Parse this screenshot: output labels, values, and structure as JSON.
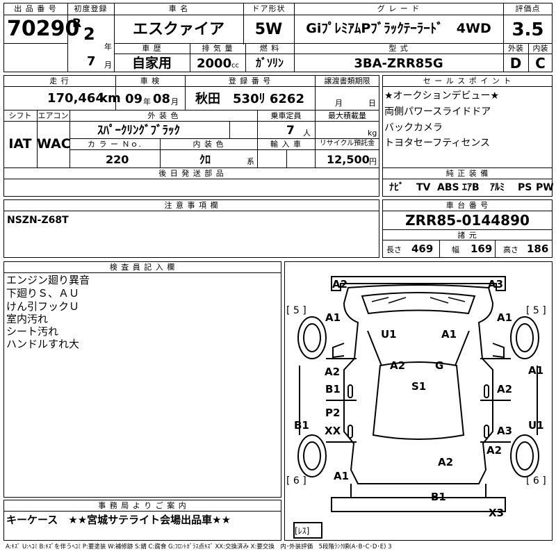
{
  "header": {
    "lot_label": "出 品 番 号",
    "lot_number": "70290",
    "first_reg_label": "初度登録",
    "era": "R",
    "year": "2",
    "year_unit": "年",
    "month": "7",
    "month_unit": "月",
    "car_name_label": "車 名",
    "car_name": "エスクァイア",
    "doors_label": "ドア形状",
    "doors": "5W",
    "grade_label": "グ レ ー ド",
    "grade": "GiﾌﾟﾚﾐｱﾑPﾌﾞﾗｯｸﾃｰﾗｰﾄﾞ　4WD",
    "score_label": "評価点",
    "score": "3.5",
    "history_label": "車 歴",
    "history": "自家用",
    "displacement_label": "排 気 量",
    "displacement": "2000",
    "displacement_unit": "cc",
    "fuel_label": "燃 料",
    "fuel": "ｶﾞｿﾘﾝ",
    "model_label": "型 式",
    "model": "3BA-ZRR85G",
    "exterior_label": "外装",
    "exterior": "D",
    "interior_label": "内装",
    "interior": "C"
  },
  "row2": {
    "mileage_label": "走 行",
    "mileage": "170,464",
    "mileage_unit": "km",
    "inspection_label": "車 検",
    "insp_year": "09",
    "insp_year_unit": "年",
    "insp_month": "08",
    "insp_month_unit": "月",
    "reg_no_label": "登 録 番 号",
    "reg_no": "秋田　530ﾘ 6262",
    "transfer_label": "譲渡書類期限",
    "transfer_month_unit": "月",
    "transfer_day_unit": "日",
    "shift_label": "シフト",
    "shift": "IAT",
    "ac_label": "エアコン",
    "ac": "WAC",
    "color_label": "外 装 色",
    "color": "ｽﾊﾟｰｸﾘﾝｸﾞﾌﾞﾗｯｸ",
    "capacity_label": "乗車定員",
    "capacity": "7",
    "capacity_unit": "人",
    "load_label": "最大積載量",
    "load_unit": "kg",
    "color_no_label": "カ ラ ー Ｎｏ.",
    "color_no": "220",
    "interior_color_label": "内 装 色",
    "interior_color": "ｸﾛ",
    "interior_color_unit": "系",
    "import_label": "輸 入 車",
    "recycle_label": "リサイクル預託金",
    "recycle": "12,500",
    "recycle_unit": "円",
    "later_parts_label": "後 日 発 送 部 品"
  },
  "sales_points": {
    "label": "セ ー ル ス ポ イ ン ト",
    "items": [
      "★オークションデビュー★",
      "両側パワースライドドア",
      "バックカメラ",
      "トヨタセーフティセンス"
    ]
  },
  "equipment": {
    "label": "純 正 装 備",
    "items": [
      "ﾅﾋﾞ",
      "TV",
      "ABS",
      "ｴｱB",
      "ｱﾙﾐ",
      "PS",
      "PW"
    ]
  },
  "notes": {
    "label": "注 意 事 項 欄",
    "text": "NSZN-Z68T"
  },
  "chassis": {
    "label": "車 台 番 号",
    "number": "ZRR85-0144890",
    "specs_label": "諸 元",
    "length_label": "長さ",
    "length": "469",
    "width_label": "幅",
    "width": "169",
    "height_label": "高さ",
    "height": "186"
  },
  "inspector": {
    "label": "検 査 員 記 入 欄",
    "lines": [
      "エンジン廻り異音",
      "下廻りＳ、ＡＵ",
      "けん引フックＵ",
      "室内汚れ",
      "シート汚れ",
      "ハンドルすれ大"
    ]
  },
  "office": {
    "label": "事 務 局 よ り ご 案 内",
    "text": "キーケース　★★宮城サテライト会場出品車★★"
  },
  "diagram": {
    "marks": [
      "A2",
      "A3",
      "A1",
      "A1",
      "U1",
      "A1",
      "A1",
      "A2",
      "G",
      "A2",
      "B1",
      "S1",
      "A2",
      "A1",
      "B1",
      "P2",
      "U1",
      "XX",
      "A3",
      "A2",
      "A2",
      "A1",
      "B1",
      "X3"
    ],
    "tires": [
      "[ 5 ]",
      "[ 5 ]",
      "[ 6 ]",
      "[ 6 ]"
    ],
    "spare": "[ﾚｽ]"
  },
  "legend": "A:ｷｽﾞ U:ﾍｺﾐ B:ｷｽﾞを伴うﾍｺﾐ P:要塗装 W:補修跡 S:錆 C:腐食 G:ﾌﾛﾝﾄｶﾞﾗｽ点ｷｽﾞ XX:交換済み X:要交換　内･外装評価　5段階ﾗﾝｸ順(A･B･C･D･E) 3"
}
